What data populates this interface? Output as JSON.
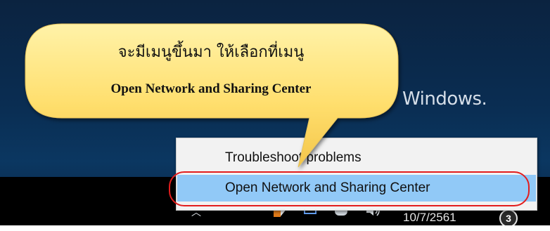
{
  "desktop": {
    "brand_text": "Windows.",
    "accent_color": "#0b3761"
  },
  "context_menu": {
    "items": [
      {
        "label": "Troubleshoot problems",
        "highlighted": false
      },
      {
        "label": "Open Network and Sharing Center",
        "highlighted": true
      }
    ],
    "highlight_color": "#91c9f7",
    "annotation_ring_color": "#e21d1d"
  },
  "callout": {
    "line1": "จะมีเมนูขึ้นมา ให้เลือกที่เมนู",
    "line2": "Open Network and Sharing Center",
    "fill_color": "#ffd966"
  },
  "taskbar": {
    "date": "10/7/2561",
    "notification_count": "3",
    "tray_icons": [
      "chevron-up-icon",
      "shield-icon",
      "network-monitor-icon",
      "cloud-icon",
      "volume-icon"
    ]
  }
}
